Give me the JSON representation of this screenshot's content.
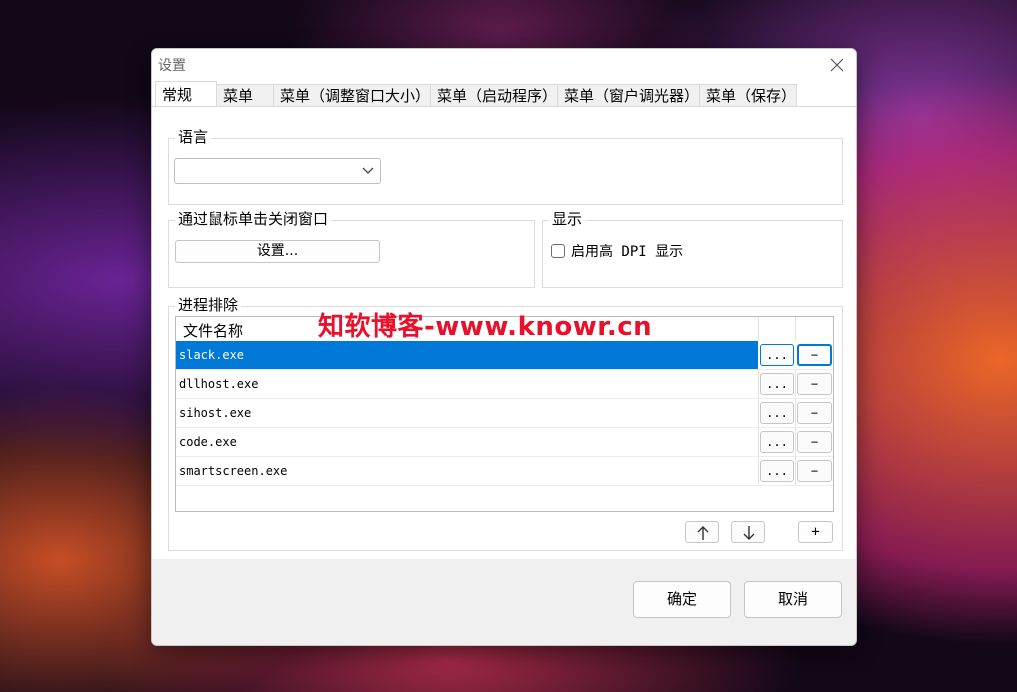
{
  "window": {
    "title": "设置"
  },
  "tabs": [
    {
      "label": "常规",
      "active": true
    },
    {
      "label": "菜单",
      "active": false
    },
    {
      "label": "菜单（调整窗口大小）",
      "active": false
    },
    {
      "label": "菜单（启动程序）",
      "active": false
    },
    {
      "label": "菜单（窗户调光器）",
      "active": false
    },
    {
      "label": "菜单（保存）",
      "active": false
    }
  ],
  "language_group": {
    "label": "语言",
    "selected": ""
  },
  "close_click_group": {
    "label": "通过鼠标单击关闭窗口",
    "button_label": "设置..."
  },
  "display_group": {
    "label": "显示",
    "checkbox_label": "启用高 DPI 显示",
    "checked": false
  },
  "process_group": {
    "label": "进程排除",
    "column_header": "文件名称",
    "browse_label": "...",
    "remove_label": "−",
    "rows": [
      {
        "name": "slack.exe",
        "selected": true
      },
      {
        "name": "dllhost.exe",
        "selected": false
      },
      {
        "name": "sihost.exe",
        "selected": false
      },
      {
        "name": "code.exe",
        "selected": false
      },
      {
        "name": "smartscreen.exe",
        "selected": false
      }
    ],
    "add_label": "+"
  },
  "footer": {
    "ok_label": "确定",
    "cancel_label": "取消"
  },
  "watermark": "知软博客-www.knowr.cn",
  "colors": {
    "selection": "#0078d7",
    "watermark": "#e8102a"
  }
}
